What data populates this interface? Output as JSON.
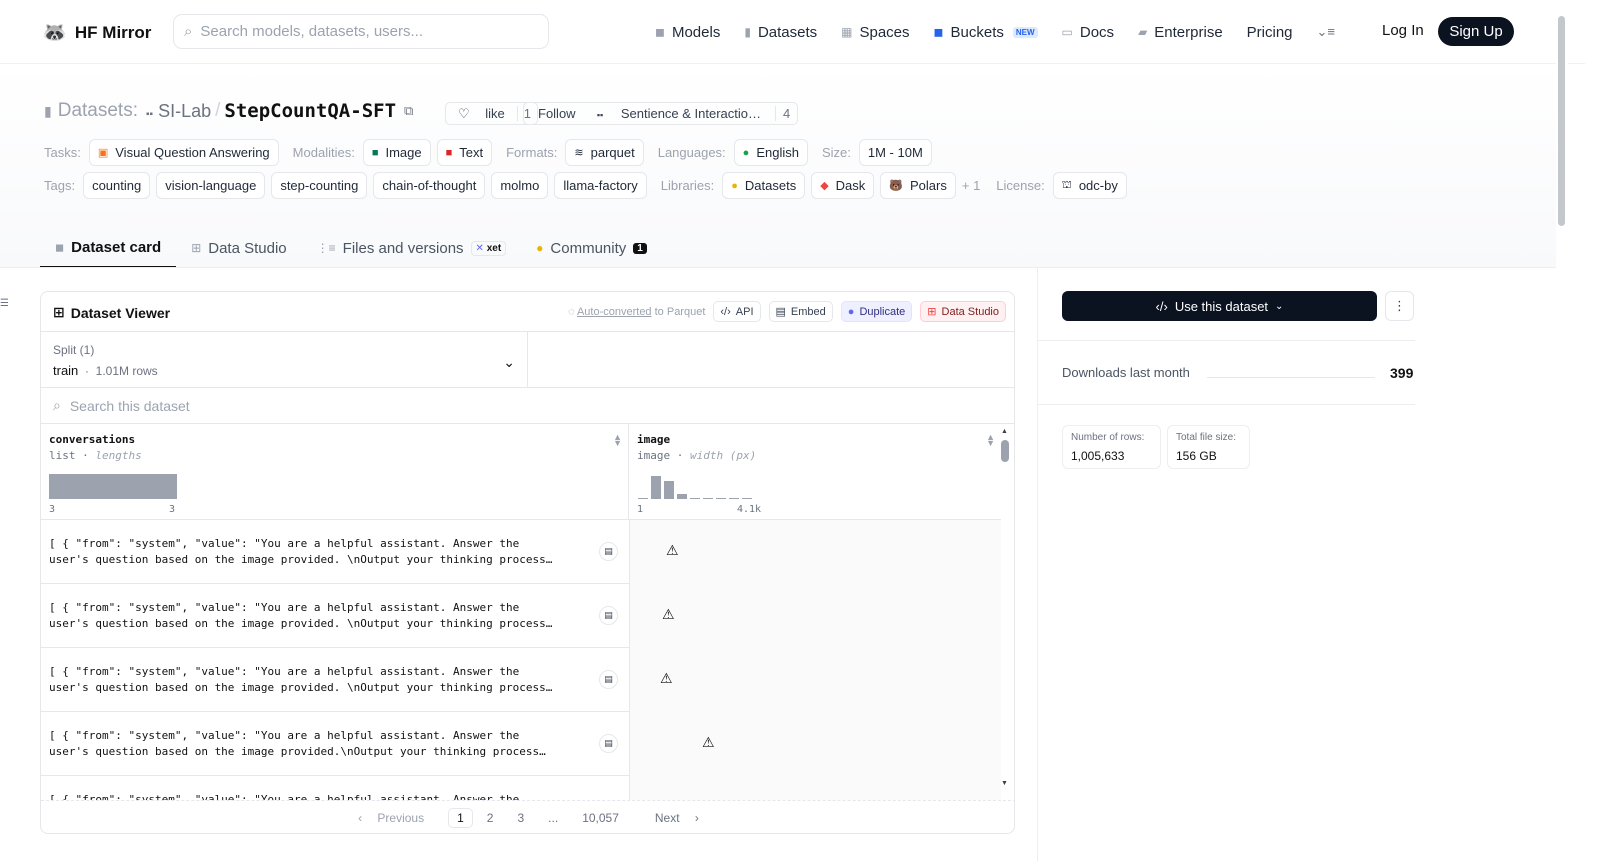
{
  "header": {
    "logo_text": "HF Mirror",
    "search_placeholder": "Search models, datasets, users...",
    "nav": [
      {
        "label": "Models",
        "icon": "cube-icon"
      },
      {
        "label": "Datasets",
        "icon": "database-icon"
      },
      {
        "label": "Spaces",
        "icon": "grid-icon"
      },
      {
        "label": "Buckets",
        "icon": "bucket-icon",
        "badge": "NEW"
      },
      {
        "label": "Docs",
        "icon": "book-icon"
      },
      {
        "label": "Enterprise",
        "icon": "building-icon"
      },
      {
        "label": "Pricing"
      }
    ],
    "login": "Log In",
    "signup": "Sign Up"
  },
  "repo": {
    "section": "Datasets:",
    "org": "SI-Lab",
    "sep": "/",
    "name": "StepCountQA-SFT",
    "like_label": "like",
    "like_count": "1",
    "follow_label": "Follow",
    "follow_org": "Sentience & Interactio…",
    "follow_count": "4"
  },
  "meta": {
    "tasks_label": "Tasks:",
    "tasks": [
      "Visual Question Answering"
    ],
    "modalities_label": "Modalities:",
    "modalities": [
      "Image",
      "Text"
    ],
    "formats_label": "Formats:",
    "formats": [
      "parquet"
    ],
    "languages_label": "Languages:",
    "languages": [
      "English"
    ],
    "size_label": "Size:",
    "size": "1M - 10M",
    "tags_label": "Tags:",
    "tags": [
      "counting",
      "vision-language",
      "step-counting",
      "chain-of-thought",
      "molmo",
      "llama-factory"
    ],
    "libraries_label": "Libraries:",
    "libraries": [
      "Datasets",
      "Dask",
      "Polars"
    ],
    "libraries_more": "+ 1",
    "license_label": "License:",
    "license": "odc-by"
  },
  "tabs": [
    {
      "label": "Dataset card",
      "active": true
    },
    {
      "label": "Data Studio"
    },
    {
      "label": "Files and versions",
      "badge": "xet"
    },
    {
      "label": "Community",
      "count": "1"
    }
  ],
  "viewer": {
    "title": "Dataset Viewer",
    "auto_converted": "Auto-converted",
    "to_parquet": "to Parquet",
    "api": "API",
    "embed": "Embed",
    "duplicate": "Duplicate",
    "data_studio": "Data Studio",
    "split_label": "Split (1)",
    "split_name": "train",
    "split_rows": "1.01M rows",
    "search_placeholder": "Search this dataset",
    "columns": [
      {
        "name": "conversations",
        "type": "list",
        "stat": "lengths",
        "min": "3",
        "max": "3"
      },
      {
        "name": "image",
        "type": "image",
        "stat": "width (px)",
        "min": "1",
        "max": "4.1k"
      }
    ],
    "image_hist": [
      0.05,
      0.9,
      0.7,
      0.2,
      0.05,
      0.03,
      0.03,
      0.03,
      0.03
    ],
    "rows": [
      {
        "line1": "[ { \"from\": \"system\", \"value\": \"You are a helpful assistant. Answer the",
        "line2": "user's question based on the image provided. \\nOutput your thinking process…"
      },
      {
        "line1": "[ { \"from\": \"system\", \"value\": \"You are a helpful assistant. Answer the",
        "line2": "user's question based on the image provided. \\nOutput your thinking process…"
      },
      {
        "line1": "[ { \"from\": \"system\", \"value\": \"You are a helpful assistant. Answer the",
        "line2": "user's question based on the image provided. \\nOutput your thinking process…"
      },
      {
        "line1": "[ { \"from\": \"system\", \"value\": \"You are a helpful assistant. Answer the",
        "line2": "user's question based on the image provided.\\nOutput your thinking process…"
      },
      {
        "line1": "[ { \"from\": \"system\", \"value\": \"You are a helpful assistant. Answer the",
        "line2": ""
      }
    ],
    "pagination": {
      "prev": "Previous",
      "pages": [
        "1",
        "2",
        "3",
        "...",
        "10,057"
      ],
      "next": "Next"
    }
  },
  "sidebar": {
    "use_dataset": "Use this dataset",
    "downloads_label": "Downloads last month",
    "downloads_value": "399",
    "rows_label": "Number of rows:",
    "rows_value": "1,005,633",
    "size_label": "Total file size:",
    "size_value": "156 GB"
  }
}
